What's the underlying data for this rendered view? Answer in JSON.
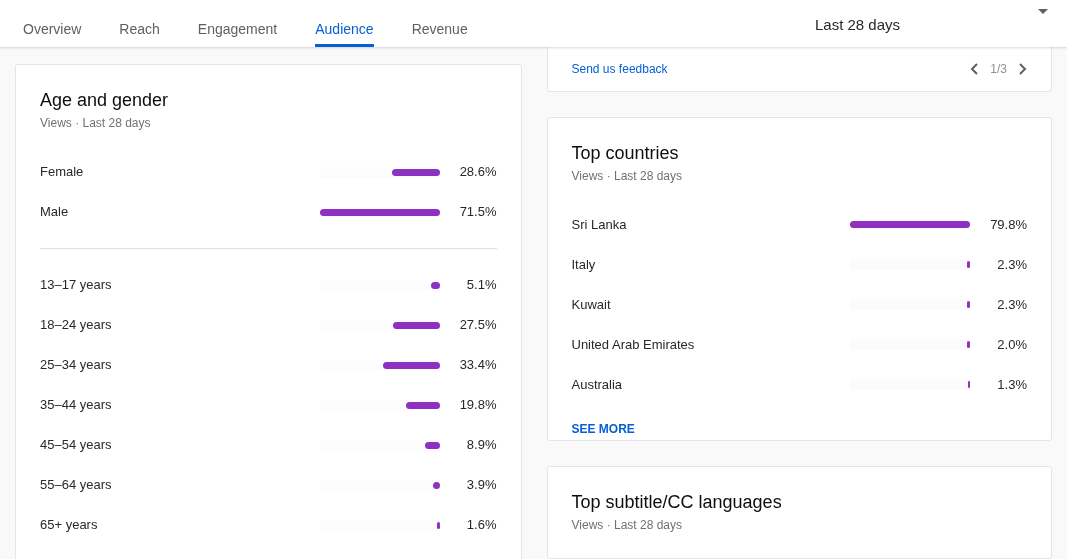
{
  "tabs": [
    {
      "label": "Overview",
      "selected": false
    },
    {
      "label": "Reach",
      "selected": false
    },
    {
      "label": "Engagement",
      "selected": false
    },
    {
      "label": "Audience",
      "selected": true
    },
    {
      "label": "Revenue",
      "selected": false
    }
  ],
  "date_range": {
    "label": "Last 28 days"
  },
  "feedback_card": {
    "link": "Send us feedback",
    "pager": "1/3"
  },
  "age_and_gender": {
    "title": "Age and gender",
    "subtitle": "Views · Last 28 days",
    "gender": [
      {
        "label": "Female",
        "level": 0.4,
        "value": "28.6%"
      },
      {
        "label": "Male",
        "level": 1,
        "value": "71.5%"
      }
    ],
    "age": [
      {
        "label": "13–17 years",
        "level": 0.071,
        "value": "5.1%"
      },
      {
        "label": "18–24 years",
        "level": 0.385,
        "value": "27.5%"
      },
      {
        "label": "25–34 years",
        "level": 0.467,
        "value": "33.4%"
      },
      {
        "label": "35–44 years",
        "level": 0.277,
        "value": "19.8%"
      },
      {
        "label": "45–54 years",
        "level": 0.124,
        "value": "8.9%"
      },
      {
        "label": "55–64 years",
        "level": 0.055,
        "value": "3.9%"
      },
      {
        "label": "65+ years",
        "level": 0.022,
        "value": "1.6%"
      }
    ]
  },
  "top_countries": {
    "title": "Top countries",
    "subtitle": "Views · Last 28 days",
    "rows": [
      {
        "label": "Sri Lanka",
        "level": 1,
        "value": "79.8%"
      },
      {
        "label": "Italy",
        "level": 0.029,
        "value": "2.3%"
      },
      {
        "label": "Kuwait",
        "level": 0.029,
        "value": "2.3%"
      },
      {
        "label": "United Arab Emirates",
        "level": 0.025,
        "value": "2.0%"
      },
      {
        "label": "Australia",
        "level": 0.016,
        "value": "1.3%"
      }
    ],
    "more": "SEE MORE"
  },
  "top_languages": {
    "title": "Top subtitle/CC languages",
    "subtitle": "Views · Last 28 days"
  }
}
